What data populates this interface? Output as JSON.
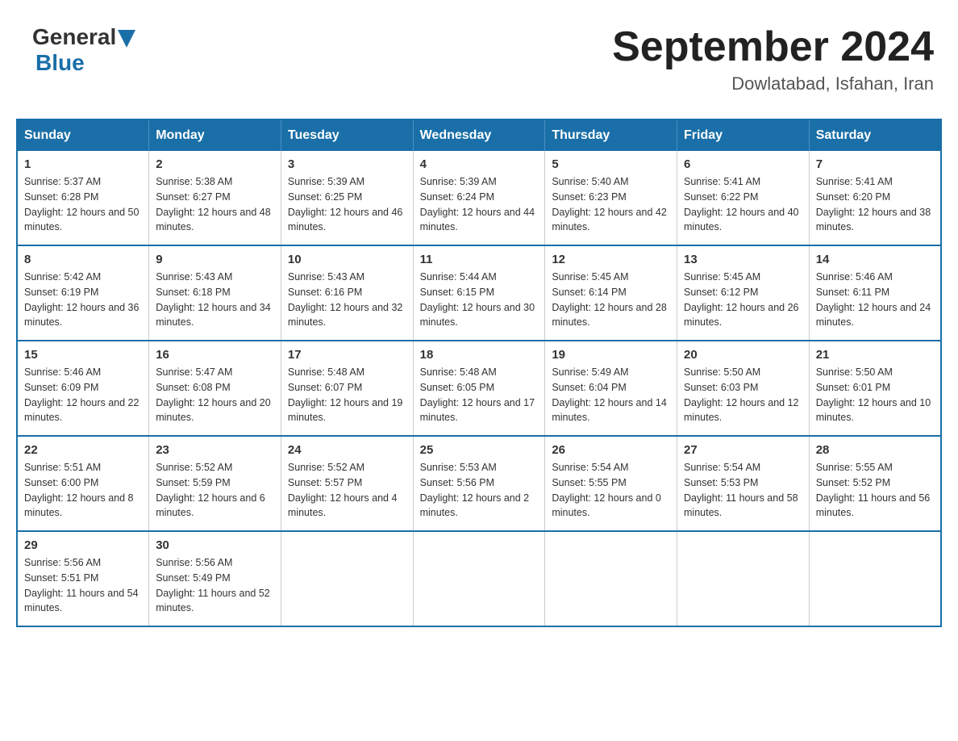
{
  "header": {
    "logo_general": "General",
    "logo_blue": "Blue",
    "title": "September 2024",
    "subtitle": "Dowlatabad, Isfahan, Iran"
  },
  "days_of_week": [
    "Sunday",
    "Monday",
    "Tuesday",
    "Wednesday",
    "Thursday",
    "Friday",
    "Saturday"
  ],
  "weeks": [
    [
      {
        "day": "1",
        "sunrise": "5:37 AM",
        "sunset": "6:28 PM",
        "daylight": "12 hours and 50 minutes."
      },
      {
        "day": "2",
        "sunrise": "5:38 AM",
        "sunset": "6:27 PM",
        "daylight": "12 hours and 48 minutes."
      },
      {
        "day": "3",
        "sunrise": "5:39 AM",
        "sunset": "6:25 PM",
        "daylight": "12 hours and 46 minutes."
      },
      {
        "day": "4",
        "sunrise": "5:39 AM",
        "sunset": "6:24 PM",
        "daylight": "12 hours and 44 minutes."
      },
      {
        "day": "5",
        "sunrise": "5:40 AM",
        "sunset": "6:23 PM",
        "daylight": "12 hours and 42 minutes."
      },
      {
        "day": "6",
        "sunrise": "5:41 AM",
        "sunset": "6:22 PM",
        "daylight": "12 hours and 40 minutes."
      },
      {
        "day": "7",
        "sunrise": "5:41 AM",
        "sunset": "6:20 PM",
        "daylight": "12 hours and 38 minutes."
      }
    ],
    [
      {
        "day": "8",
        "sunrise": "5:42 AM",
        "sunset": "6:19 PM",
        "daylight": "12 hours and 36 minutes."
      },
      {
        "day": "9",
        "sunrise": "5:43 AM",
        "sunset": "6:18 PM",
        "daylight": "12 hours and 34 minutes."
      },
      {
        "day": "10",
        "sunrise": "5:43 AM",
        "sunset": "6:16 PM",
        "daylight": "12 hours and 32 minutes."
      },
      {
        "day": "11",
        "sunrise": "5:44 AM",
        "sunset": "6:15 PM",
        "daylight": "12 hours and 30 minutes."
      },
      {
        "day": "12",
        "sunrise": "5:45 AM",
        "sunset": "6:14 PM",
        "daylight": "12 hours and 28 minutes."
      },
      {
        "day": "13",
        "sunrise": "5:45 AM",
        "sunset": "6:12 PM",
        "daylight": "12 hours and 26 minutes."
      },
      {
        "day": "14",
        "sunrise": "5:46 AM",
        "sunset": "6:11 PM",
        "daylight": "12 hours and 24 minutes."
      }
    ],
    [
      {
        "day": "15",
        "sunrise": "5:46 AM",
        "sunset": "6:09 PM",
        "daylight": "12 hours and 22 minutes."
      },
      {
        "day": "16",
        "sunrise": "5:47 AM",
        "sunset": "6:08 PM",
        "daylight": "12 hours and 20 minutes."
      },
      {
        "day": "17",
        "sunrise": "5:48 AM",
        "sunset": "6:07 PM",
        "daylight": "12 hours and 19 minutes."
      },
      {
        "day": "18",
        "sunrise": "5:48 AM",
        "sunset": "6:05 PM",
        "daylight": "12 hours and 17 minutes."
      },
      {
        "day": "19",
        "sunrise": "5:49 AM",
        "sunset": "6:04 PM",
        "daylight": "12 hours and 14 minutes."
      },
      {
        "day": "20",
        "sunrise": "5:50 AM",
        "sunset": "6:03 PM",
        "daylight": "12 hours and 12 minutes."
      },
      {
        "day": "21",
        "sunrise": "5:50 AM",
        "sunset": "6:01 PM",
        "daylight": "12 hours and 10 minutes."
      }
    ],
    [
      {
        "day": "22",
        "sunrise": "5:51 AM",
        "sunset": "6:00 PM",
        "daylight": "12 hours and 8 minutes."
      },
      {
        "day": "23",
        "sunrise": "5:52 AM",
        "sunset": "5:59 PM",
        "daylight": "12 hours and 6 minutes."
      },
      {
        "day": "24",
        "sunrise": "5:52 AM",
        "sunset": "5:57 PM",
        "daylight": "12 hours and 4 minutes."
      },
      {
        "day": "25",
        "sunrise": "5:53 AM",
        "sunset": "5:56 PM",
        "daylight": "12 hours and 2 minutes."
      },
      {
        "day": "26",
        "sunrise": "5:54 AM",
        "sunset": "5:55 PM",
        "daylight": "12 hours and 0 minutes."
      },
      {
        "day": "27",
        "sunrise": "5:54 AM",
        "sunset": "5:53 PM",
        "daylight": "11 hours and 58 minutes."
      },
      {
        "day": "28",
        "sunrise": "5:55 AM",
        "sunset": "5:52 PM",
        "daylight": "11 hours and 56 minutes."
      }
    ],
    [
      {
        "day": "29",
        "sunrise": "5:56 AM",
        "sunset": "5:51 PM",
        "daylight": "11 hours and 54 minutes."
      },
      {
        "day": "30",
        "sunrise": "5:56 AM",
        "sunset": "5:49 PM",
        "daylight": "11 hours and 52 minutes."
      },
      null,
      null,
      null,
      null,
      null
    ]
  ],
  "labels": {
    "sunrise": "Sunrise:",
    "sunset": "Sunset:",
    "daylight": "Daylight:"
  }
}
